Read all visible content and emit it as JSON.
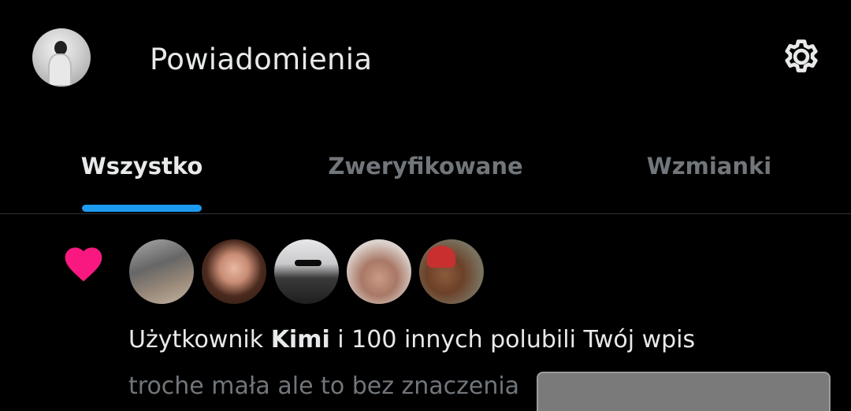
{
  "header": {
    "title": "Powiadomienia",
    "avatar_icon": "user-avatar",
    "settings_icon": "gear-icon"
  },
  "tabs": [
    {
      "label": "Wszystko",
      "active": true
    },
    {
      "label": "Zweryfikowane",
      "active": false
    },
    {
      "label": "Wzmianki",
      "active": false
    }
  ],
  "colors": {
    "background": "#000000",
    "text_primary": "#e7e9ea",
    "text_secondary": "#71767b",
    "accent": "#1d9bf0",
    "like": "#f91880"
  },
  "notification": {
    "icon": "heart-icon",
    "avatar_count": 5,
    "text_prefix": "Użytkownik ",
    "user": "Kimi",
    "text_suffix": " i 100 innych polubili Twój wpis",
    "post_snippet": "troche mała ale to bez znaczenia"
  }
}
